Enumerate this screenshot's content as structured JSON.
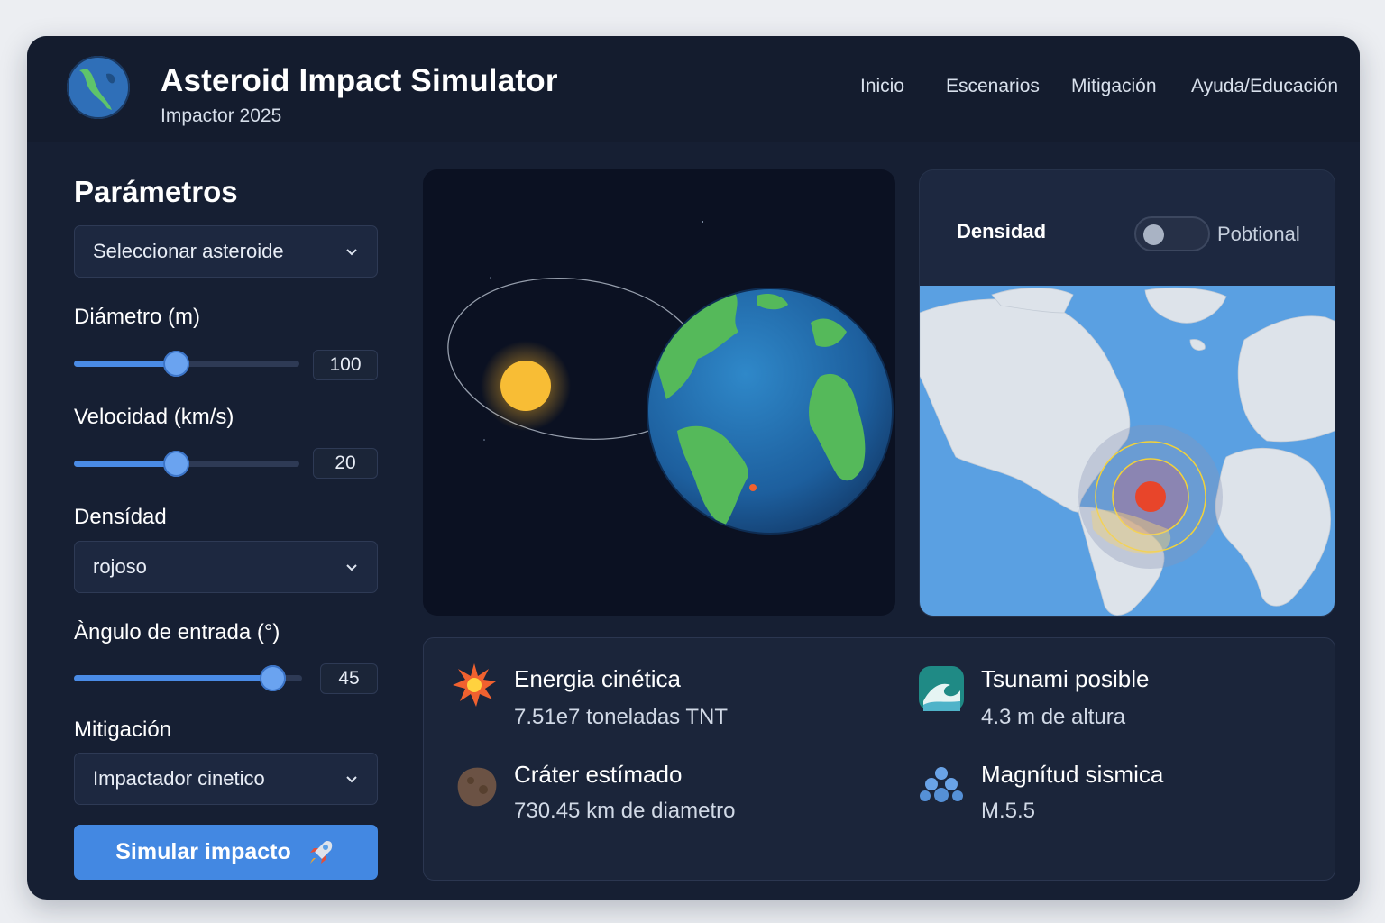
{
  "header": {
    "title": "Asteroid Impact Simulator",
    "subtitle": "Impactor 2025",
    "nav": [
      "Inicio",
      "Escenarios",
      "Mitigación",
      "Ayuda/Educación"
    ]
  },
  "params": {
    "title": "Parámetros",
    "asteroid_select": "Seleccionar asteroide",
    "diameter": {
      "label": "Diámetro (m)",
      "value": "100",
      "fraction": 0.45
    },
    "velocity": {
      "label": "Velocidad (km/s)",
      "value": "20",
      "fraction": 0.45
    },
    "density": {
      "label": "Densídad",
      "selected": "rojoso"
    },
    "angle": {
      "label": "Àngulo de entrada (°)",
      "value": "45",
      "fraction": 0.87
    },
    "mitigation": {
      "label": "Mitigación",
      "selected": "Impactador cinetico"
    },
    "simulate_button": "Simular impacto"
  },
  "map_panel": {
    "label": "Densidad",
    "toggle_label": "Pobtional",
    "toggle_on": false
  },
  "results": [
    {
      "icon": "explosion-icon",
      "title": "Energia cinética",
      "value": "7.51e7 toneladas TNT"
    },
    {
      "icon": "wave-icon",
      "title": "Tsunami posible",
      "value": "4.3 m de altura"
    },
    {
      "icon": "crater-rock-icon",
      "title": "Cráter estímado",
      "value": "730.45 km de diametro"
    },
    {
      "icon": "seismic-icon",
      "title": "Magnítud sismica",
      "value": "M.5.5"
    }
  ],
  "colors": {
    "accent": "#4388e2",
    "background": "#161f33",
    "impact": "#e8452a"
  }
}
